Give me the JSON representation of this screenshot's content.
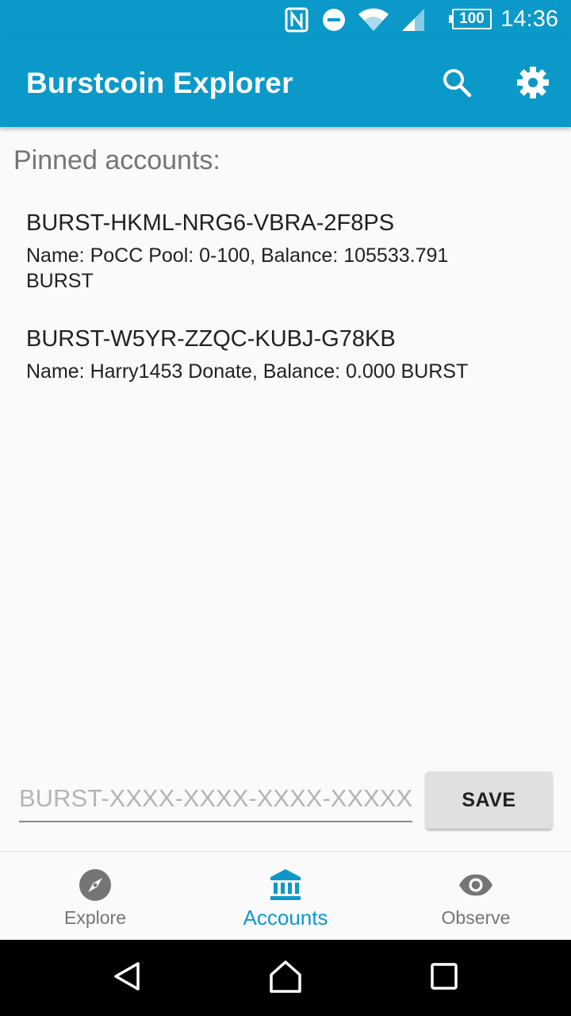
{
  "status_bar": {
    "time": "14:36",
    "battery": "100",
    "icons": [
      "nfc-icon",
      "do-not-disturb-icon",
      "wifi-icon",
      "cell-signal-icon",
      "battery-icon"
    ]
  },
  "app_bar": {
    "title": "Burstcoin Explorer",
    "actions": [
      "search-icon",
      "settings-icon"
    ]
  },
  "main": {
    "section_title": "Pinned accounts:",
    "accounts": [
      {
        "address": "BURST-HKML-NRG6-VBRA-2F8PS",
        "info": "Name: PoCC Pool: 0-100, Balance: 105533.791 BURST"
      },
      {
        "address": "BURST-W5YR-ZZQC-KUBJ-G78KB",
        "info": "Name: Harry1453 Donate, Balance: 0.000 BURST"
      }
    ],
    "address_input": {
      "value": "",
      "placeholder": "BURST-XXXX-XXXX-XXXX-XXXXX"
    },
    "save_label": "SAVE"
  },
  "bottom_nav": {
    "items": [
      {
        "label": "Explore",
        "icon": "compass-icon",
        "active": false
      },
      {
        "label": "Accounts",
        "icon": "bank-icon",
        "active": true
      },
      {
        "label": "Observe",
        "icon": "eye-icon",
        "active": false
      }
    ]
  },
  "system_nav": [
    "back-icon",
    "home-icon",
    "recents-icon"
  ],
  "colors": {
    "primary": "#0b99c9",
    "background": "#fafafa",
    "inactive": "#757575"
  }
}
